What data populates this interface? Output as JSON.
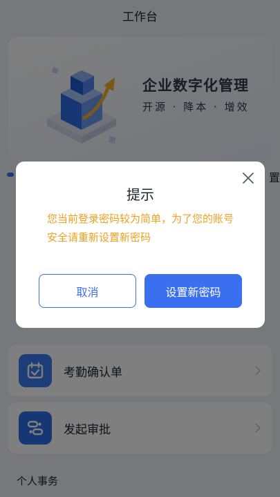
{
  "header": {
    "title": "工作台"
  },
  "banner": {
    "headline": "企业数字化管理",
    "subtitle": "开源 · 降本 · 增效"
  },
  "edge_text": "置",
  "cards": [
    {
      "label": "考勤确认单",
      "icon": "calendar-check-icon",
      "color": "#3a7bf0"
    },
    {
      "label": "发起审批",
      "icon": "approval-flow-icon",
      "color": "#2f6fe8"
    }
  ],
  "section": {
    "title": "个人事务"
  },
  "dialog": {
    "title": "提示",
    "message": "您当前登录密码较为简单，为了您的账号安全请重新设置新密码",
    "cancel_label": "取消",
    "confirm_label": "设置新密码"
  },
  "colors": {
    "accent": "#3a6ff0",
    "warning": "#f0a020"
  }
}
